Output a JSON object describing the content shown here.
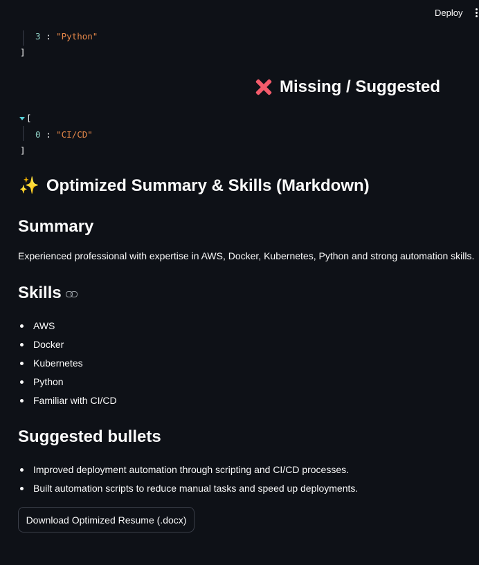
{
  "header": {
    "deploy_label": "Deploy"
  },
  "json_present_tail": {
    "index": "3",
    "value": "\"Python\"",
    "close_bracket": "]"
  },
  "missing": {
    "heading": "Missing / Suggested",
    "icon": "red-cross-mark-icon",
    "open_bracket": "[",
    "items": [
      {
        "index": "0",
        "value": "\"CI/CD\""
      }
    ],
    "close_bracket": "]"
  },
  "optimized": {
    "heading": "Optimized Summary & Skills (Markdown)",
    "icon": "sparkles-icon"
  },
  "summary": {
    "heading": "Summary",
    "text": "Experienced professional with expertise in AWS, Docker, Kubernetes, Python and strong automation skills."
  },
  "skills": {
    "heading": "Skills",
    "items": [
      "AWS",
      "Docker",
      "Kubernetes",
      "Python",
      "Familiar with CI/CD"
    ]
  },
  "suggested": {
    "heading": "Suggested bullets",
    "items": [
      "Improved deployment automation through scripting and CI/CD processes.",
      "Built automation scripts to reduce manual tasks and speed up deployments."
    ]
  },
  "download_label": "Download Optimized Resume (.docx)",
  "colors": {
    "background": "#0e1117",
    "json_string": "#e8894a",
    "json_index": "#8fd0c5",
    "cross": "#f25b6b",
    "sparkle": "#f6c945"
  }
}
